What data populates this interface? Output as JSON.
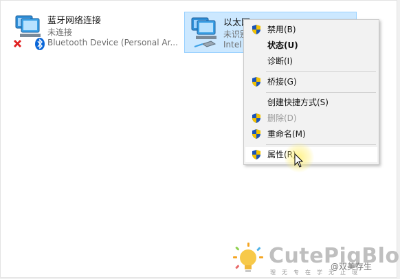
{
  "connections": [
    {
      "name": "蓝牙网络连接",
      "status": "未连接",
      "device": "Bluetooth Device (Personal Ar..."
    },
    {
      "name": "以太网",
      "status": "未识别",
      "device": "Intel"
    }
  ],
  "context_menu": {
    "items": [
      {
        "label": "禁用(B)",
        "icon": "uac-shield-icon"
      },
      {
        "label": "状态(U)",
        "bold": true
      },
      {
        "label": "诊断(I)"
      },
      {
        "label": "桥接(G)",
        "icon": "uac-shield-icon"
      },
      {
        "label": "创建快捷方式(S)"
      },
      {
        "label": "删除(D)",
        "icon": "uac-shield-icon",
        "disabled": true
      },
      {
        "label": "重命名(M)",
        "icon": "uac-shield-icon"
      },
      {
        "label": "属性(R)",
        "icon": "uac-shield-icon",
        "hovered": true
      }
    ]
  },
  "watermark": {
    "brand": "CutePigBlog",
    "tagline": "理无专在学无止境",
    "credit": "@双美存生"
  },
  "colors": {
    "selection_bg": "#cce8ff",
    "selection_border": "#99d1ff",
    "menu_bg": "#f2f2f2",
    "bluetooth_blue": "#0a66d8",
    "shield_blue": "#1a54b8",
    "shield_yellow": "#f3c200"
  }
}
